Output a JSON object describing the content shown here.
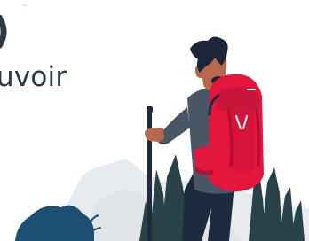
{
  "headline": {
    "text": "uvoir"
  },
  "decor": {
    "top_glyph": ")",
    "spark_glyph": "+"
  },
  "colors": {
    "text_dark": "#2c3747",
    "backpack_red": "#e3163d",
    "backpack_shadow": "#b40f30",
    "hair_dark": "#1c2638",
    "skin_brown": "#b7694d",
    "jacket_gray": "#4a5566",
    "pants_dark": "#1e2a3d",
    "tree_dark": "#294248",
    "bush_blue": "#1d4f74",
    "hill_gray": "#e7ebef"
  }
}
